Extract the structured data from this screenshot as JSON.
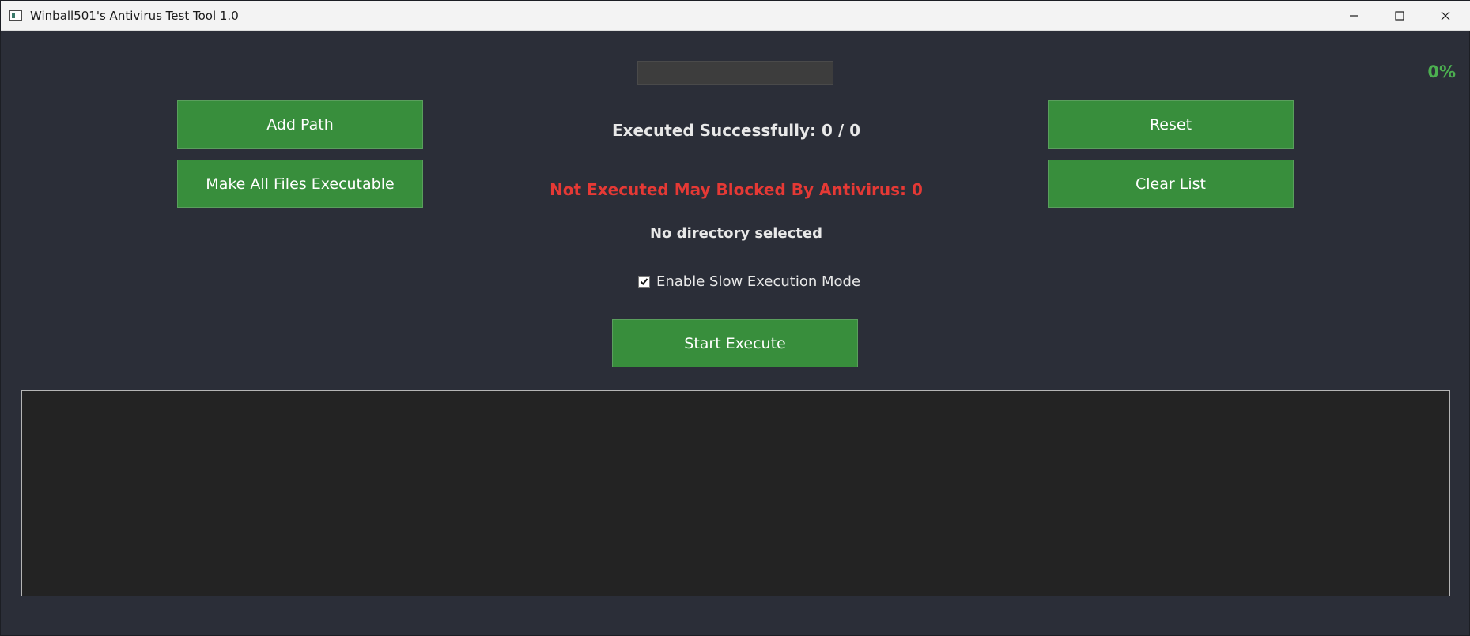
{
  "window": {
    "title": "Winball501's Antivirus Test Tool 1.0",
    "controls": {
      "minimize_icon": "minimize-icon",
      "maximize_icon": "maximize-icon",
      "close_icon": "close-icon"
    }
  },
  "progress": {
    "value": 0,
    "percent_label": "0%"
  },
  "buttons": {
    "add_path": "Add Path",
    "make_executable": "Make All Files Executable",
    "reset": "Reset",
    "clear_list": "Clear List",
    "start_execute": "Start Execute"
  },
  "status": {
    "executed_successfully": "Executed Successfully: 0 / 0",
    "not_executed": "Not Executed May Blocked By Antivirus: 0",
    "directory": "No directory selected"
  },
  "options": {
    "slow_mode_label": "Enable Slow Execution Mode",
    "slow_mode_checked": true
  },
  "colors": {
    "background": "#2b2e38",
    "button_green": "#388e3c",
    "percent_green": "#4caf50",
    "error_red": "#e53935",
    "log_background": "#232323"
  }
}
